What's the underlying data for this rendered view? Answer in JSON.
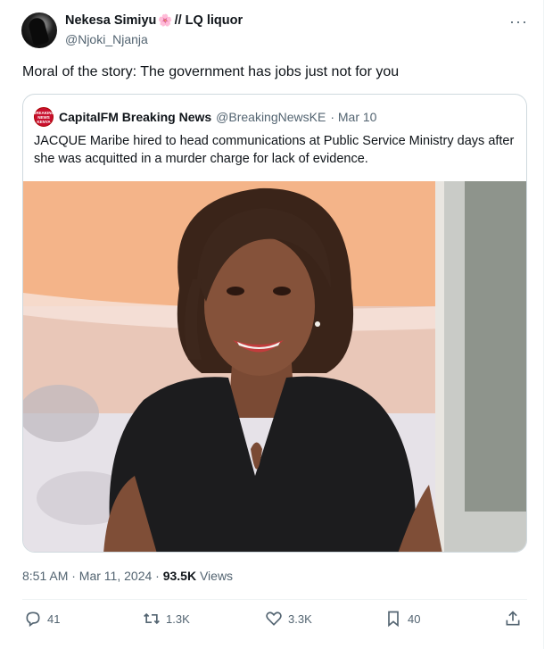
{
  "tweet": {
    "author_name": "Nekesa Simiyu",
    "author_suffix": "// LQ liquor",
    "flower_icon": "🌸",
    "handle": "@Njoki_Njanja",
    "more_icon": "···",
    "text": "Moral of the story: The government has jobs just not for you"
  },
  "quote": {
    "logo_lines": [
      "BREAKING",
      "NEWS",
      "KENYA"
    ],
    "author_name": "CapitalFM Breaking News",
    "handle": "@BreakingNewsKE",
    "date": "· Mar 10",
    "text": "JACQUE Maribe hired to head communications at Public Service Ministry days after she was acquitted in a murder charge for lack of evidence."
  },
  "meta": {
    "time": "8:51 AM · Mar 11, 2024 · ",
    "views_count": "93.5K",
    "views_label": " Views"
  },
  "actions": {
    "replies": "41",
    "reposts": "1.3K",
    "likes": "3.3K",
    "bookmarks": "40"
  },
  "colors": {
    "text": "#0f1419",
    "muted": "#536471",
    "border": "#cfd9de",
    "logo_red": "#c8102e"
  }
}
